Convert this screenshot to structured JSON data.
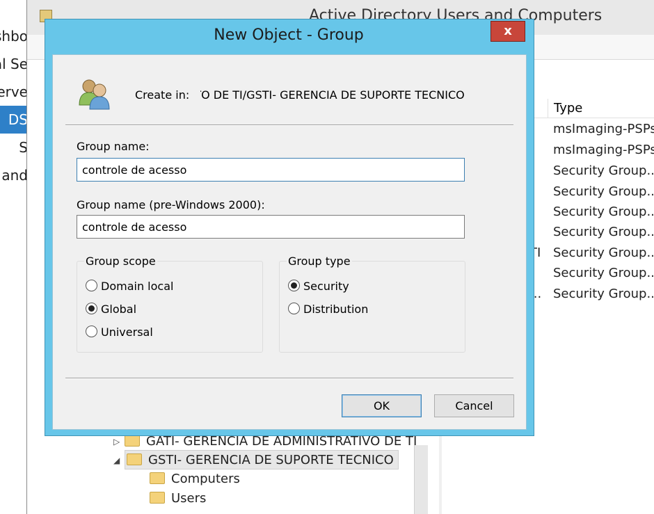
{
  "server_manager": {
    "nav_items": [
      {
        "label": "shbo"
      },
      {
        "label": "al Se"
      },
      {
        "label": "Serve"
      },
      {
        "label": "DS",
        "selected": true
      },
      {
        "label": "S"
      },
      {
        "label": "and"
      }
    ]
  },
  "aduc": {
    "title": "Active Directory Users and Computers",
    "list": {
      "type_header": "Type",
      "rows": [
        {
          "name": "",
          "type": "msImaging-PSPs"
        },
        {
          "name": "",
          "type": "msImaging-PSPs"
        },
        {
          "name": "",
          "type": "Security Group..."
        },
        {
          "name": "",
          "type": "Security Group..."
        },
        {
          "name": "",
          "type": "Security Group..."
        },
        {
          "name": "",
          "type": "Security Group..."
        },
        {
          "name": "TI",
          "type": "Security Group..."
        },
        {
          "name": "",
          "type": "Security Group..."
        },
        {
          "name": "...",
          "type": "Security Group..."
        }
      ]
    },
    "tree": {
      "gati": "GATI- GERENCIA DE ADMINISTRATIVO DE TI",
      "gsti": "GSTI- GERENCIA DE SUPORTE TECNICO",
      "computers": "Computers",
      "users": "Users"
    }
  },
  "dialog": {
    "title": "New Object - Group",
    "close_label": "x",
    "create_in_label": "Create in:",
    "create_in_path": "DEPARTAMENTO DE TI/GSTI- GERENCIA DE SUPORTE TECNICO",
    "group_name_label": "Group name:",
    "group_name_value": "controle de acesso",
    "group_name_pre2000_label": "Group name (pre-Windows 2000):",
    "group_name_pre2000_value": "controle de acesso",
    "group_scope": {
      "legend": "Group scope",
      "options": [
        "Domain local",
        "Global",
        "Universal"
      ],
      "selected": "Global"
    },
    "group_type": {
      "legend": "Group type",
      "options": [
        "Security",
        "Distribution"
      ],
      "selected": "Security"
    },
    "ok_label": "OK",
    "cancel_label": "Cancel"
  },
  "colors": {
    "dialog_frame": "#67c6e9",
    "close_button": "#c8463a",
    "selection": "#2e80c8"
  }
}
